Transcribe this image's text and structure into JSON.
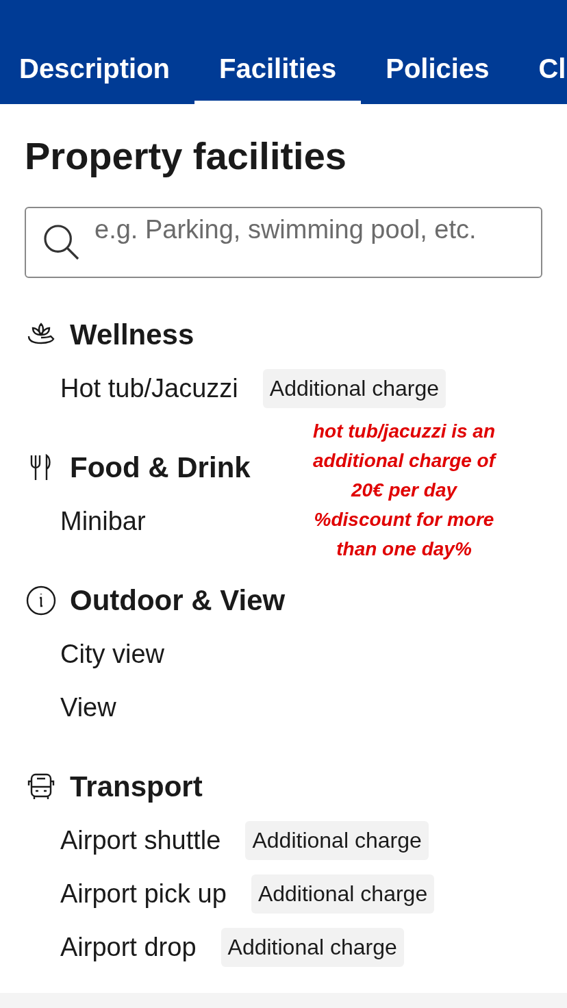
{
  "tabs": [
    {
      "label": "Description",
      "selected": false
    },
    {
      "label": "Facilities",
      "selected": true
    },
    {
      "label": "Policies",
      "selected": false
    },
    {
      "label": "Cl",
      "selected": false
    }
  ],
  "heading": "Property facilities",
  "search": {
    "placeholder": "e.g. Parking, swimming pool, etc."
  },
  "sections": [
    {
      "kind": "wellness",
      "title": "Wellness",
      "items": [
        {
          "name": "Hot tub/Jacuzzi",
          "badge": "Additional charge"
        }
      ]
    },
    {
      "kind": "food",
      "title": "Food & Drink",
      "items": [
        {
          "name": "Minibar"
        }
      ]
    },
    {
      "kind": "info",
      "title": "Outdoor & View",
      "items": [
        {
          "name": "City view"
        },
        {
          "name": "View"
        }
      ]
    },
    {
      "kind": "transport",
      "title": "Transport",
      "items": [
        {
          "name": "Airport shuttle",
          "badge": "Additional charge"
        },
        {
          "name": "Airport pick up",
          "badge": "Additional charge"
        },
        {
          "name": "Airport drop",
          "badge": "Additional charge"
        }
      ]
    }
  ],
  "annotation": "hot tub/jacuzzi is an\nadditional charge of\n20€ per day\n%discount for more\nthan one day%"
}
